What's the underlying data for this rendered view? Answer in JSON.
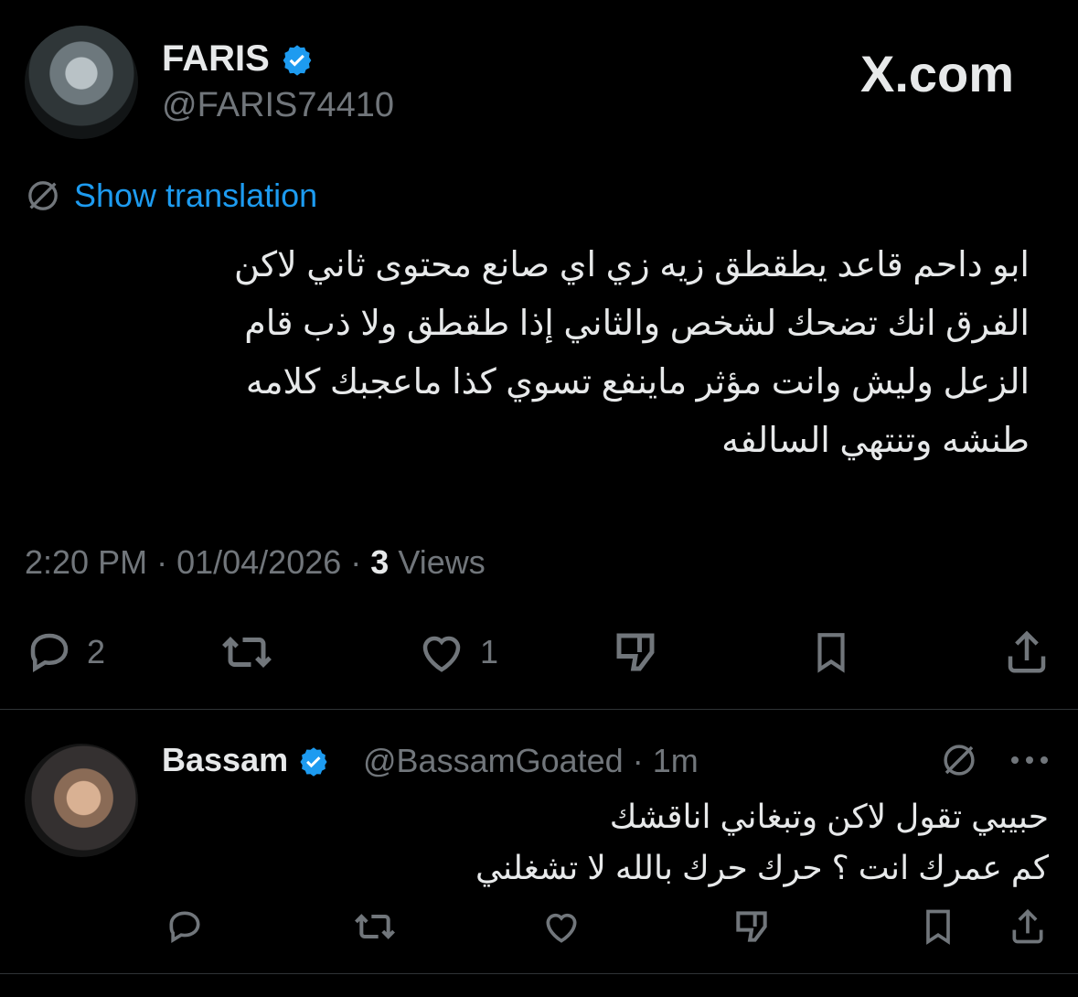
{
  "main_tweet": {
    "author_name": "FARIS",
    "author_handle": "@FARIS74410",
    "brand": "X.com",
    "show_translation": "Show translation",
    "text_lines": [
      "ابو داحم قاعد يطقطق زيه زي اي صانع محتوى ثاني لاكن",
      "الفرق انك تضحك لشخص والثاني إذا طقطق ولا ذب قام",
      "الزعل وليش وانت مؤثر ماينفع تسوي كذا ماعجبك كلامه",
      "طنشه وتنتهي السالفه"
    ],
    "time": "2:20 PM",
    "date": "01/04/2026",
    "views_count": "3",
    "views_label": "Views",
    "replies": "2",
    "likes": "1"
  },
  "reply_tweet": {
    "author_name": "Bassam",
    "author_handle": "@BassamGoated",
    "time_ago": "1m",
    "text_lines": [
      "حبيبي تقول لاكن وتبغاني اناقشك",
      "كم عمرك انت ؟ حرك حرك بالله لا تشغلني"
    ]
  },
  "colors": {
    "background": "#000000",
    "text": "#e7e9ea",
    "muted": "#71767b",
    "accent": "#1d9bf0"
  }
}
